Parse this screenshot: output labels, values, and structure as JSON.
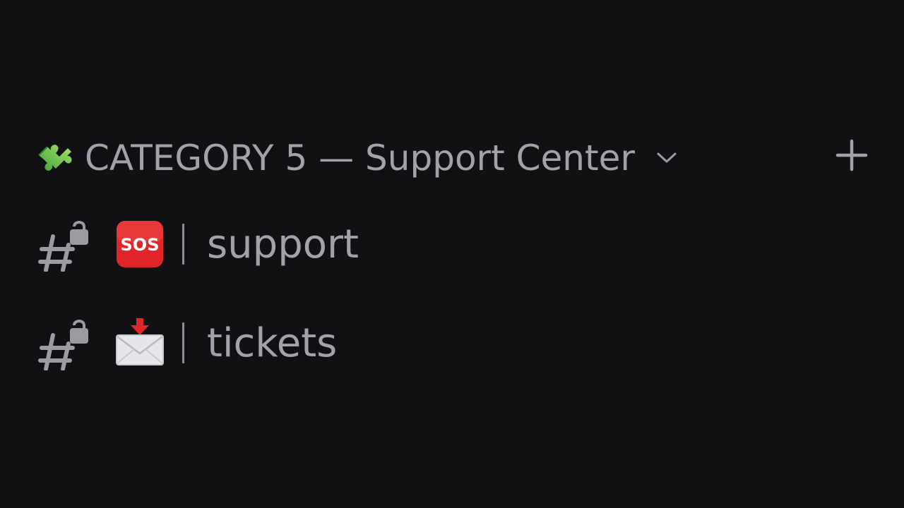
{
  "category": {
    "emoji_icon": "puzzle-piece-icon",
    "title": "CATEGORY 5 — Support Center",
    "chevron_icon": "chevron-down-icon",
    "add_icon": "plus-icon"
  },
  "channels": [
    {
      "type_icon": "locked-text-channel-icon",
      "emoji_icon": "sos-icon",
      "emoji_text": "SOS",
      "separator": "|",
      "name": "support"
    },
    {
      "type_icon": "locked-text-channel-icon",
      "emoji_icon": "envelope-arrow-icon",
      "separator": "|",
      "name": "tickets"
    }
  ],
  "colors": {
    "background": "#111113",
    "text": "#a2a3aa",
    "sos_red": "#e0262b",
    "puzzle_green": "#6ccf3e"
  }
}
